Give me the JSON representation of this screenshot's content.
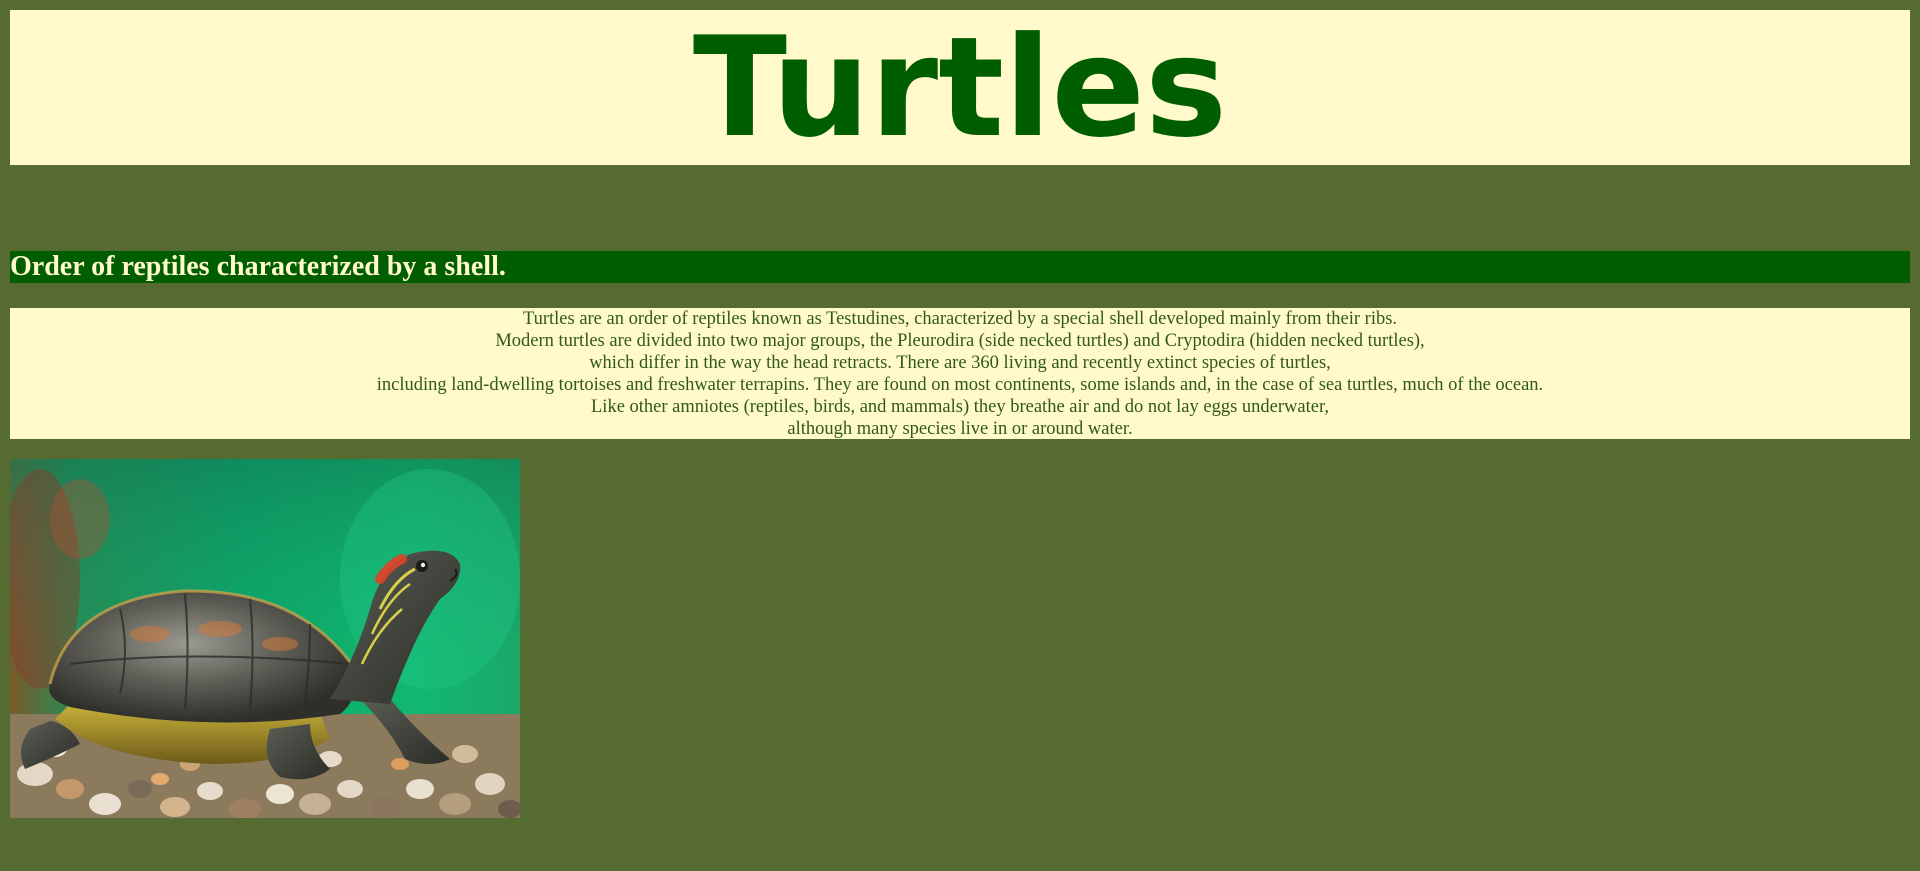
{
  "header": {
    "title": "Turtles"
  },
  "section": {
    "heading": "Order of reptiles characterized by a shell."
  },
  "intro": {
    "lines": [
      "Turtles are an order of reptiles known as Testudines, characterized by a special shell developed mainly from their ribs.",
      "Modern turtles are divided into two major groups, the Pleurodira (side necked turtles) and Cryptodira (hidden necked turtles),",
      "which differ in the way the head retracts. There are 360 living and recently extinct species of turtles,",
      "including land-dwelling tortoises and freshwater terrapins. They are found on most continents, some islands and, in the case of sea turtles, much of the ocean.",
      "Like other amniotes (reptiles, birds, and mammals) they breathe air and do not lay eggs underwater,",
      "although many species live in or around water."
    ]
  },
  "colors": {
    "page_background": "#566b31",
    "banner_background": "#fff9cb",
    "title_text": "#005e00",
    "subtitle_background": "#005e00",
    "subtitle_text": "#fff9cb",
    "intro_text": "#2f5a17"
  }
}
